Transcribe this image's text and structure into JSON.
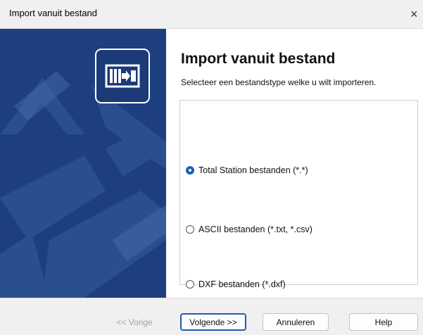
{
  "window": {
    "title": "Import vanuit bestand",
    "close_glyph": "×"
  },
  "sidebar": {
    "logo_icon": "import-file-icon",
    "background_color": "#1e3f7f"
  },
  "main": {
    "heading": "Import vanuit bestand",
    "subheading": "Selecteer een bestandstype welke u wilt importeren.",
    "options": [
      {
        "label": "Total Station bestanden (*.*)",
        "checked": true
      },
      {
        "label": "ASCII bestanden (*.txt, *.csv)",
        "checked": false
      },
      {
        "label": "DXF bestanden (*.dxf)",
        "checked": false
      }
    ]
  },
  "footer": {
    "back_label": "<< Vorige",
    "next_label": "Volgende >>",
    "cancel_label": "Annuleren",
    "help_label": "Help"
  },
  "colors": {
    "accent": "#1f5cb5",
    "sidebar": "#1e3f7f"
  }
}
